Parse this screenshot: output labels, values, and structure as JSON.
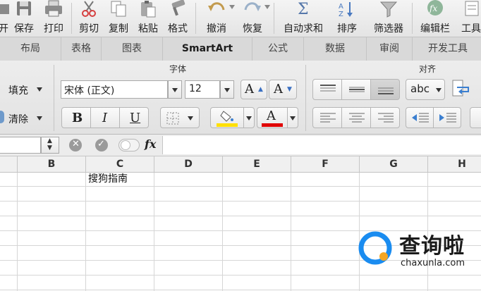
{
  "toolbar": {
    "items": [
      {
        "label": "开",
        "icon": "open-folder-icon"
      },
      {
        "label": "保存",
        "icon": "save-icon"
      },
      {
        "label": "打印",
        "icon": "print-icon"
      },
      {
        "label": "剪切",
        "icon": "cut-icon"
      },
      {
        "label": "复制",
        "icon": "copy-icon"
      },
      {
        "label": "粘贴",
        "icon": "paste-icon"
      },
      {
        "label": "格式",
        "icon": "format-brush-icon"
      },
      {
        "label": "撤消",
        "icon": "undo-icon"
      },
      {
        "label": "恢复",
        "icon": "redo-icon"
      },
      {
        "label": "自动求和",
        "icon": "autosum-icon"
      },
      {
        "label": "排序",
        "icon": "sort-icon"
      },
      {
        "label": "筛选器",
        "icon": "filter-icon"
      },
      {
        "label": "编辑栏",
        "icon": "formula-bar-icon"
      },
      {
        "label": "工具",
        "icon": "toolbox-icon"
      }
    ]
  },
  "tabs": [
    "布局",
    "表格",
    "图表",
    "SmartArt",
    "公式",
    "数据",
    "审阅",
    "开发工具"
  ],
  "ribbon": {
    "font_group_title": "字体",
    "align_group_title": "对齐",
    "fill_label": "填充",
    "clear_label": "清除",
    "font_name": "宋体 (正文)",
    "font_size": "12",
    "increase_font": "A",
    "decrease_font": "A",
    "bold": "B",
    "italic": "I",
    "underline": "U",
    "font_color_letter": "A",
    "wrap_label": "abc",
    "colors": {
      "highlight": "#ffe000",
      "font_color": "#e00000"
    }
  },
  "formula_bar": {
    "fx": "fx",
    "name_box": ""
  },
  "columns": [
    "B",
    "C",
    "D",
    "E",
    "F",
    "G",
    "H"
  ],
  "cells": {
    "C1": "搜狗指南"
  },
  "watermark": {
    "brand": "查询啦",
    "domain": "chaxunla.com",
    "colors": {
      "ring": "#1a8cf0",
      "dot": "#f5a623"
    }
  }
}
